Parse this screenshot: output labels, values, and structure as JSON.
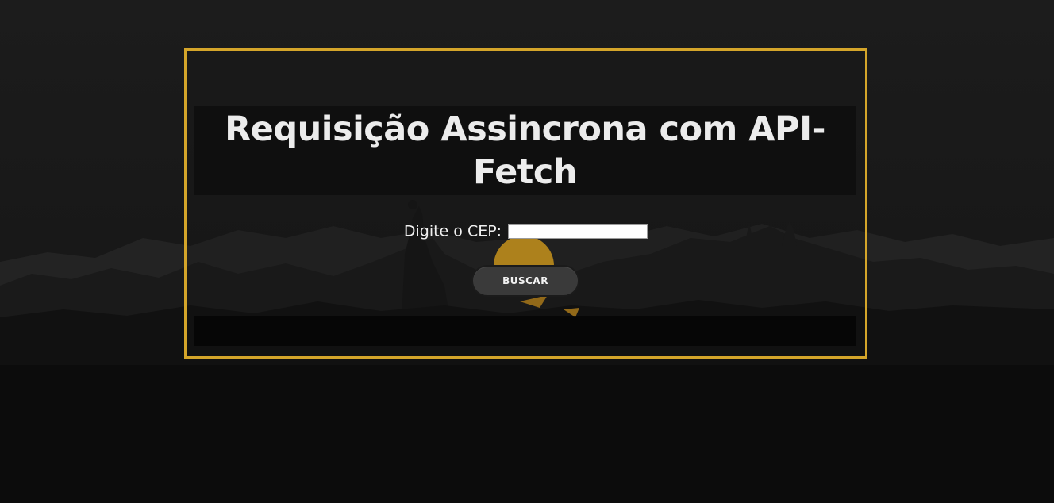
{
  "page": {
    "title": "Requisição Assincrona com API-Fetch"
  },
  "form": {
    "cep_label": "Digite o CEP:",
    "cep_value": "",
    "cep_placeholder": "",
    "search_button_label": "BUSCAR"
  },
  "result": {
    "text": ""
  },
  "colors": {
    "accent": "#d4a52a",
    "background": "#141414",
    "button": "#3a3a3a"
  }
}
